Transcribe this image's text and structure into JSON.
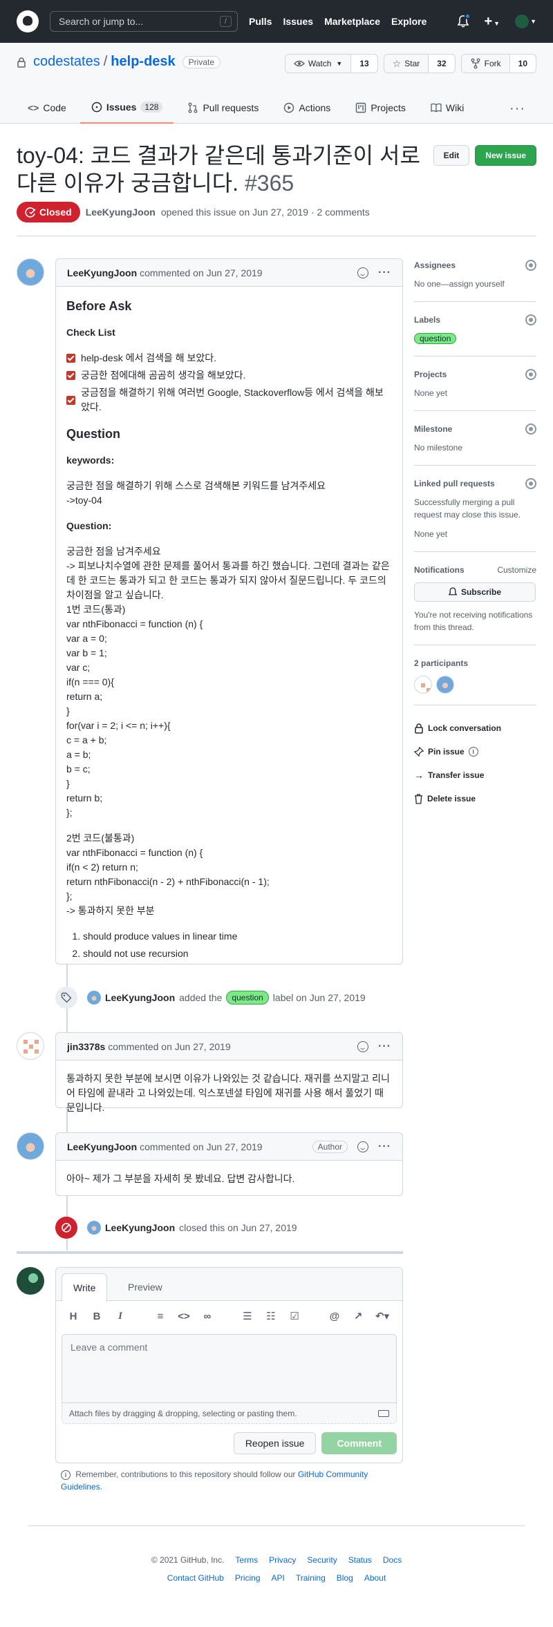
{
  "nav": {
    "search_placeholder": "Search or jump to...",
    "search_key": "/",
    "links": [
      "Pulls",
      "Issues",
      "Marketplace",
      "Explore"
    ]
  },
  "repo": {
    "owner": "codestates",
    "separator": "/",
    "name": "help-desk",
    "visibility": "Private",
    "watch_label": "Watch",
    "watch_count": "13",
    "star_label": "Star",
    "star_count": "32",
    "fork_label": "Fork",
    "fork_count": "10",
    "tabs": [
      {
        "label": "Code"
      },
      {
        "label": "Issues",
        "count": "128"
      },
      {
        "label": "Pull requests"
      },
      {
        "label": "Actions"
      },
      {
        "label": "Projects"
      },
      {
        "label": "Wiki"
      }
    ],
    "more": "···"
  },
  "issue": {
    "title": "toy-04: 코드 결과가 같은데 통과기준이 서로 다른 이유가 궁금합니다.",
    "number": "#365",
    "edit_label": "Edit",
    "new_issue_label": "New issue",
    "state": "Closed",
    "author": "LeeKyungJoon",
    "opened_text": "opened this issue on Jun 27, 2019 · 2 comments"
  },
  "first_comment": {
    "author": "LeeKyungJoon",
    "meta": "commented on Jun 27, 2019",
    "h_before_ask": "Before Ask",
    "h_check_list": "Check List",
    "checklist": [
      "help-desk 에서 검색을 해 보았다.",
      "궁금한 점에대해 곰곰히 생각을 해보았다.",
      "궁금점을 해결하기 위해 여러번 Google, Stackoverflow등 에서 검색을 해보았다."
    ],
    "h_question": "Question",
    "h_keywords": "keywords:",
    "keywords_p1": "궁금한 점을 해결하기 위해 스스로 검색해본 키워드를 남겨주세요",
    "keywords_p2": "->toy-04",
    "h_question2": "Question:",
    "q_lines": [
      "궁금한 점을 남겨주세요",
      "-> 피보나치수열에 관한 문제를 풀어서 통과를 하긴 했습니다. 그런데 결과는 같은데 한 코드는 통과가 되고 한 코드는 통과가 되지 않아서 질문드립니다. 두 코드의 차이점을 알고 싶습니다.",
      "1번 코드(통과)",
      "var nthFibonacci = function (n) {",
      "var a = 0;",
      "var b = 1;",
      "var c;",
      "if(n === 0){",
      "return a;",
      "}",
      "for(var i = 2; i <= n; i++){",
      "c = a + b;",
      "a = b;",
      "b = c;",
      "}",
      "return b;",
      "};"
    ],
    "q2_lines": [
      "2번 코드(불통과)",
      "var nthFibonacci = function (n) {",
      "if(n < 2) return n;",
      "return nthFibonacci(n - 2) + nthFibonacci(n - 1);",
      "};",
      "-> 통과하지 못한 부분"
    ],
    "failures": [
      "should produce values in linear time",
      "should not use recursion"
    ]
  },
  "label_event": {
    "actor": "LeeKyungJoon",
    "text1": "added the",
    "label": "question",
    "text2": "label on Jun 27, 2019"
  },
  "second_comment": {
    "author": "jin3378s",
    "meta": "commented on Jun 27, 2019",
    "body": "통과하지 못한 부분에 보시면 이유가 나와있는 것 같습니다. 재귀를 쓰지말고 리니어 타임에 끝내라 고 나와있는데. 익스포넨셜 타임에 재귀를 사용 해서 풀었기 때문입니다."
  },
  "third_comment": {
    "author": "LeeKyungJoon",
    "meta": "commented on Jun 27, 2019",
    "badge": "Author",
    "body": "아아~ 제가 그 부분을 자세히 못 봤네요. 답변 감사합니다."
  },
  "close_event": {
    "actor": "LeeKyungJoon",
    "text": "closed this on Jun 27, 2019"
  },
  "sidebar": {
    "assignees_title": "Assignees",
    "assignees_value": "No one—assign yourself",
    "labels_title": "Labels",
    "labels_value": "question",
    "projects_title": "Projects",
    "projects_value": "None yet",
    "milestone_title": "Milestone",
    "milestone_value": "No milestone",
    "linked_title": "Linked pull requests",
    "linked_desc": "Successfully merging a pull request may close this issue.",
    "linked_value": "None yet",
    "notifications_title": "Notifications",
    "customize": "Customize",
    "subscribe": "Subscribe",
    "notif_desc": "You're not receiving notifications from this thread.",
    "participants_title": "2 participants",
    "lock": "Lock conversation",
    "pin": "Pin issue",
    "transfer": "Transfer issue",
    "delete": "Delete issue"
  },
  "form": {
    "write_tab": "Write",
    "preview_tab": "Preview",
    "placeholder": "Leave a comment",
    "attach": "Attach files by dragging & dropping, selecting or pasting them.",
    "reopen": "Reopen issue",
    "comment": "Comment",
    "remember_text": "Remember, contributions to this repository should follow our",
    "remember_link": "GitHub Community Guidelines."
  },
  "footer": {
    "copyright": "© 2021 GitHub, Inc.",
    "row1": [
      "Terms",
      "Privacy",
      "Security",
      "Status",
      "Docs"
    ],
    "row2": [
      "Contact GitHub",
      "Pricing",
      "API",
      "Training",
      "Blog",
      "About"
    ]
  },
  "colors": {
    "closed": "#cf222e",
    "green_button": "#2da44e",
    "label_question": "#7ee787",
    "link": "#0969da"
  }
}
